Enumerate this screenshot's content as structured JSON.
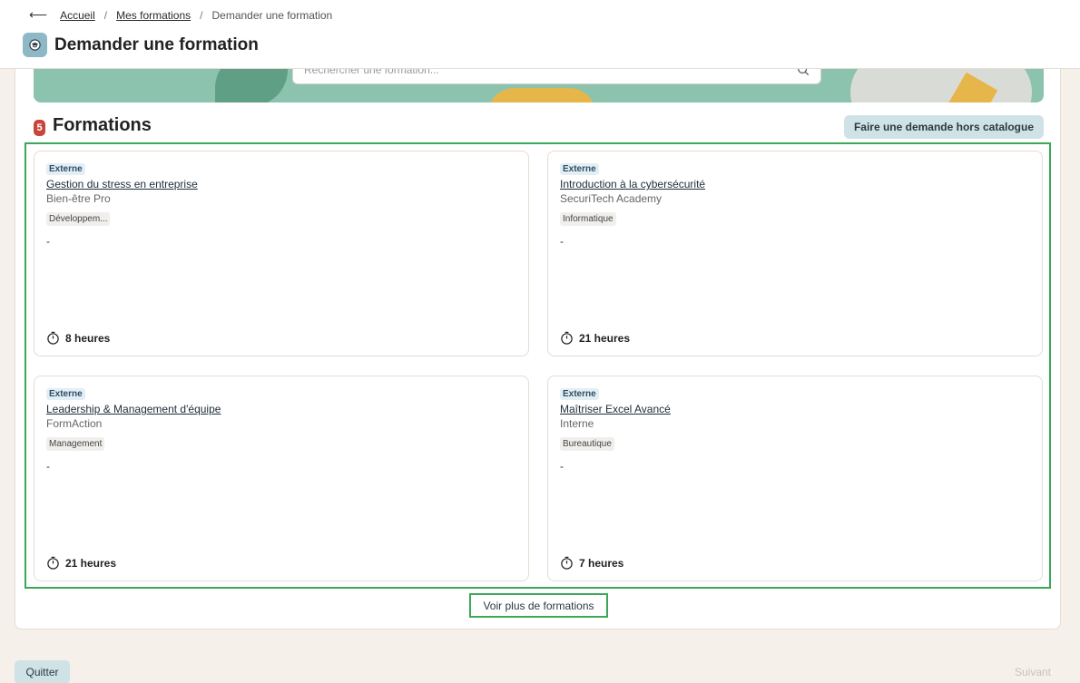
{
  "breadcrumb": {
    "back_icon": "arrow-left-icon",
    "items": [
      "Accueil",
      "Mes formations",
      "Demander une formation"
    ]
  },
  "header": {
    "icon": "graduation-cap-icon",
    "title": "Demander une formation"
  },
  "search": {
    "placeholder": "Rechercher une formation...",
    "icon": "search-icon"
  },
  "section": {
    "count": "5",
    "title": "Formations",
    "off_catalog_button": "Faire une demande hors catalogue"
  },
  "cards": [
    {
      "type": "Externe",
      "title": "Gestion du stress en entreprise",
      "provider": "Bien-être Pro",
      "category": "Développem...",
      "description": "-",
      "duration": "8 heures"
    },
    {
      "type": "Externe",
      "title": "Introduction à la cybersécurité",
      "provider": "SecuriTech Academy",
      "category": "Informatique",
      "description": "-",
      "duration": "21 heures"
    },
    {
      "type": "Externe",
      "title": "Leadership & Management d'équipe",
      "provider": "FormAction",
      "category": "Management",
      "description": "-",
      "duration": "21 heures"
    },
    {
      "type": "Externe",
      "title": "Maîtriser Excel Avancé",
      "provider": "Interne",
      "category": "Bureautique",
      "description": "-",
      "duration": "7 heures"
    }
  ],
  "more_button": "Voir plus de formations",
  "footer": {
    "quit": "Quitter",
    "next": "Suivant"
  },
  "colors": {
    "accent": "#cfe2e6",
    "badge": "#c8453c",
    "highlight": "#3aa857",
    "banner": "#8cc3ae"
  }
}
